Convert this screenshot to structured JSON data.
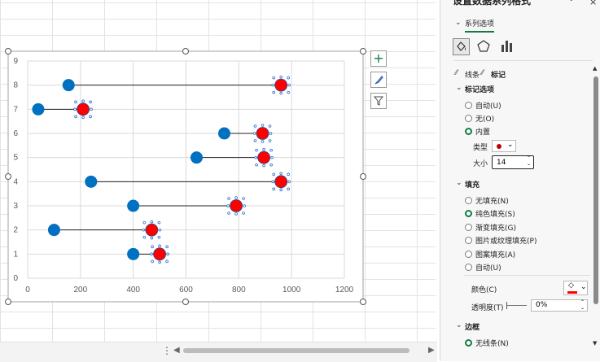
{
  "pane": {
    "title": "设置数据系列格式",
    "tab_series": "系列选项",
    "tab_line": "线条",
    "tab_marker": "标记",
    "section_marker_options": "标记选项",
    "marker_options": [
      {
        "label": "自动(U)",
        "selected": false
      },
      {
        "label": "无(O)",
        "selected": false
      },
      {
        "label": "内置",
        "selected": true
      }
    ],
    "type_label": "类型",
    "size_label": "大小",
    "size_value": "14",
    "section_fill": "填充",
    "fill_options": [
      {
        "label": "无填充(N)",
        "selected": false
      },
      {
        "label": "纯色填充(S)",
        "selected": true
      },
      {
        "label": "渐变填充(G)",
        "selected": false
      },
      {
        "label": "图片或纹理填充(P)",
        "selected": false
      },
      {
        "label": "图案填充(A)",
        "selected": false
      },
      {
        "label": "自动(U)",
        "selected": false
      }
    ],
    "color_label": "颜色(C)",
    "transparency_label": "透明度(T)",
    "transparency_value": "0%",
    "section_border": "边框",
    "border_option": "无线条(N)",
    "accent_color": "#107c41",
    "marker_color": "#ff0000"
  },
  "chart_data": {
    "type": "scatter",
    "xlim": [
      0,
      1200
    ],
    "ylim": [
      0,
      9
    ],
    "x_ticks": [
      0,
      200,
      400,
      600,
      800,
      1000,
      1200
    ],
    "y_ticks": [
      0,
      1,
      2,
      3,
      4,
      5,
      6,
      7,
      8,
      9
    ],
    "grid": true,
    "series": [
      {
        "color": "#0070c0",
        "points": [
          [
            400,
            1
          ],
          [
            100,
            2
          ],
          [
            400,
            3
          ],
          [
            240,
            4
          ],
          [
            640,
            5
          ],
          [
            745,
            6
          ],
          [
            40,
            7
          ],
          [
            155,
            8
          ]
        ]
      },
      {
        "color": "#ff0000",
        "points": [
          [
            500,
            1
          ],
          [
            470,
            2
          ],
          [
            790,
            3
          ],
          [
            960,
            4
          ],
          [
            895,
            5
          ],
          [
            890,
            6
          ],
          [
            210,
            7
          ],
          [
            960,
            8
          ]
        ]
      }
    ],
    "connectors": [
      [
        400,
        500,
        1
      ],
      [
        100,
        470,
        2
      ],
      [
        400,
        790,
        3
      ],
      [
        240,
        960,
        4
      ],
      [
        640,
        895,
        5
      ],
      [
        745,
        890,
        6
      ],
      [
        40,
        210,
        7
      ],
      [
        155,
        960,
        8
      ]
    ]
  }
}
